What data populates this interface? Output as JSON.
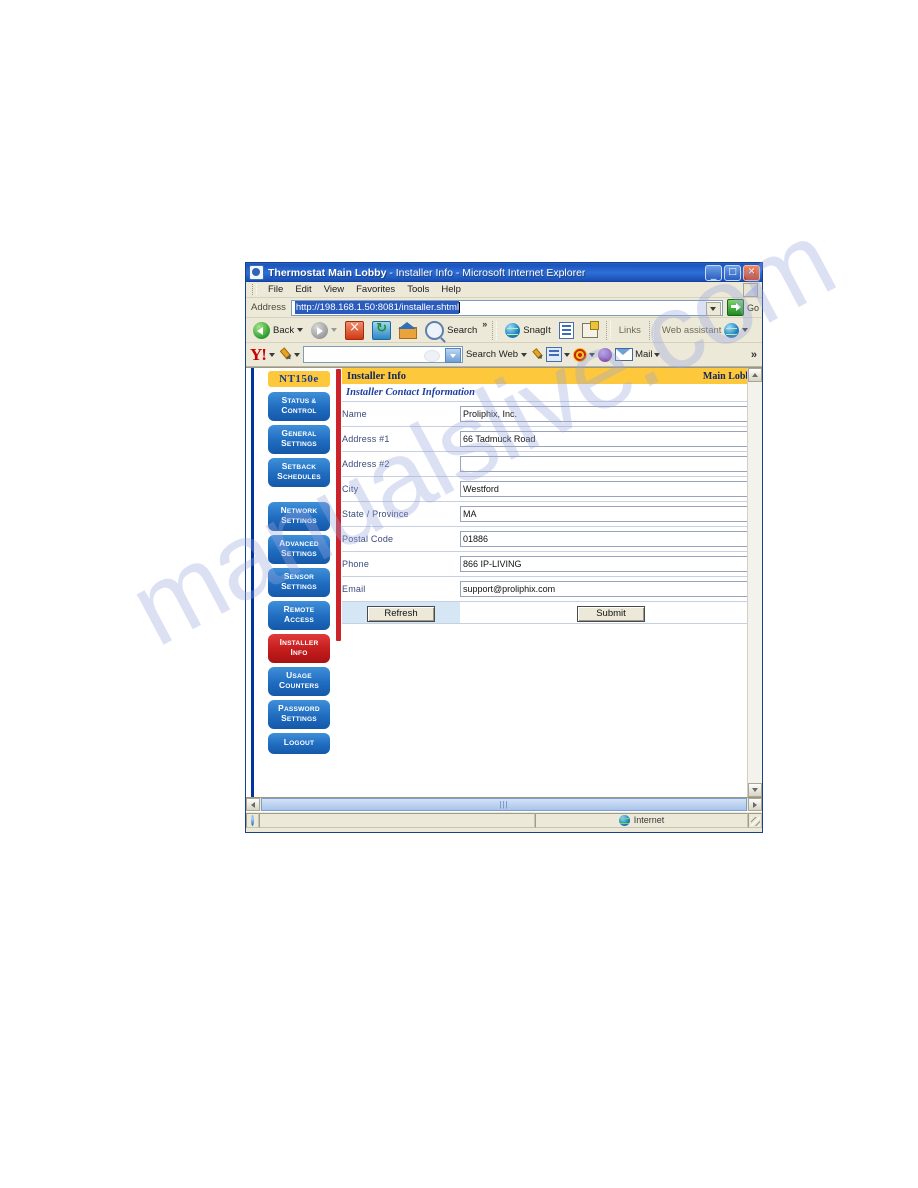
{
  "window": {
    "title_app": "Thermostat Main Lobby",
    "title_page": " - Installer Info - Microsoft Internet Explorer",
    "icon": "ie-document-icon",
    "controls": {
      "minimize": "_",
      "maximize": "□",
      "close": "✕"
    }
  },
  "menubar": {
    "items": [
      "File",
      "Edit",
      "View",
      "Favorites",
      "Tools",
      "Help"
    ]
  },
  "addressbar": {
    "label": "Address",
    "url": "http://198.168.1.50:8081/installer.shtml",
    "go_label": "Go"
  },
  "navtoolbar": {
    "back_label": "Back",
    "search_label": "Search",
    "snagit_label": "SnagIt",
    "links_label": "Links",
    "web_assistant_label": "Web assistant",
    "overflow": "»"
  },
  "yahoobar": {
    "logo": "Y!",
    "search_value": "",
    "search_web_label": "Search Web",
    "mail_label": "Mail",
    "overflow": "»"
  },
  "sidebar": {
    "brand": "NT150e",
    "items": [
      {
        "line1": "Status &",
        "line2": "Control",
        "active": false
      },
      {
        "line1": "General",
        "line2": "Settings",
        "active": false
      },
      {
        "line1": "Setback",
        "line2": "Schedules",
        "active": false
      },
      {
        "line1": "Network",
        "line2": "Settings",
        "active": false,
        "gap_before": true
      },
      {
        "line1": "Advanced",
        "line2": "Settings",
        "active": false
      },
      {
        "line1": "Sensor",
        "line2": "Settings",
        "active": false
      },
      {
        "line1": "Remote",
        "line2": "Access",
        "active": false
      },
      {
        "line1": "Installer",
        "line2": "Info",
        "active": true
      },
      {
        "line1": "Usage",
        "line2": "Counters",
        "active": false
      },
      {
        "line1": "Password",
        "line2": "Settings",
        "active": false
      },
      {
        "line1": "Logout",
        "line2": "",
        "active": false
      }
    ]
  },
  "content": {
    "header_left": "Installer Info",
    "header_right": "Main Lobby",
    "section_title": "Installer Contact Information",
    "fields": [
      {
        "label": "Name",
        "value": "Proliphix, Inc."
      },
      {
        "label": "Address #1",
        "value": "66 Tadmuck Road"
      },
      {
        "label": "Address #2",
        "value": ""
      },
      {
        "label": "City",
        "value": "Westford"
      },
      {
        "label": "State / Province",
        "value": "MA"
      },
      {
        "label": "Postal Code",
        "value": "01886"
      },
      {
        "label": "Phone",
        "value": "866 IP-LIVING"
      },
      {
        "label": "Email",
        "value": "support@proliphix.com"
      }
    ],
    "refresh_label": "Refresh",
    "submit_label": "Submit"
  },
  "statusbar": {
    "message": "",
    "zone": "Internet"
  },
  "watermark": {
    "line1": "manualslive.com"
  },
  "colors": {
    "accent_yellow": "#fdc83c",
    "nav_blue": "#1f6cc0",
    "active_red": "#c41c1c",
    "heading_blue": "#1d3fa0",
    "refresh_cell": "#d5e6f5"
  }
}
